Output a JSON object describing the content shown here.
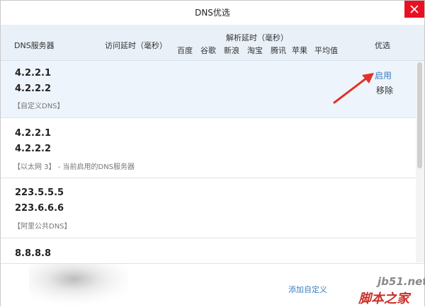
{
  "window": {
    "title": "DNS优选"
  },
  "header": {
    "col_server": "DNS服务器",
    "col_visit_delay": "访问延时（毫秒）",
    "col_parse_delay": "解析延时（毫秒）",
    "sites": [
      "百度",
      "谷歌",
      "新浪",
      "淘宝",
      "腾讯",
      "苹果",
      "平均值"
    ],
    "col_optimal": "优选"
  },
  "rows": [
    {
      "ip1": "4.2.2.1",
      "ip2": "4.2.2.2",
      "tag": "【自定义DNS】",
      "enable_label": "启用",
      "remove_label": "移除"
    },
    {
      "ip1": "4.2.2.1",
      "ip2": "4.2.2.2",
      "tag": "【以太网 3】 - 当前启用的DNS服务器"
    },
    {
      "ip1": "223.5.5.5",
      "ip2": "223.6.6.6",
      "tag": "【阿里公共DNS】"
    },
    {
      "ip1": "8.8.8.8"
    }
  ],
  "footer": {
    "add_custom": "添加自定义"
  },
  "watermark": {
    "line1": "jb51.net",
    "line2": "脚本之家"
  },
  "colors": {
    "header_bg": "#e9f0f8",
    "link": "#3b7fc4",
    "close": "#e81123",
    "arrow": "#e0322b"
  }
}
